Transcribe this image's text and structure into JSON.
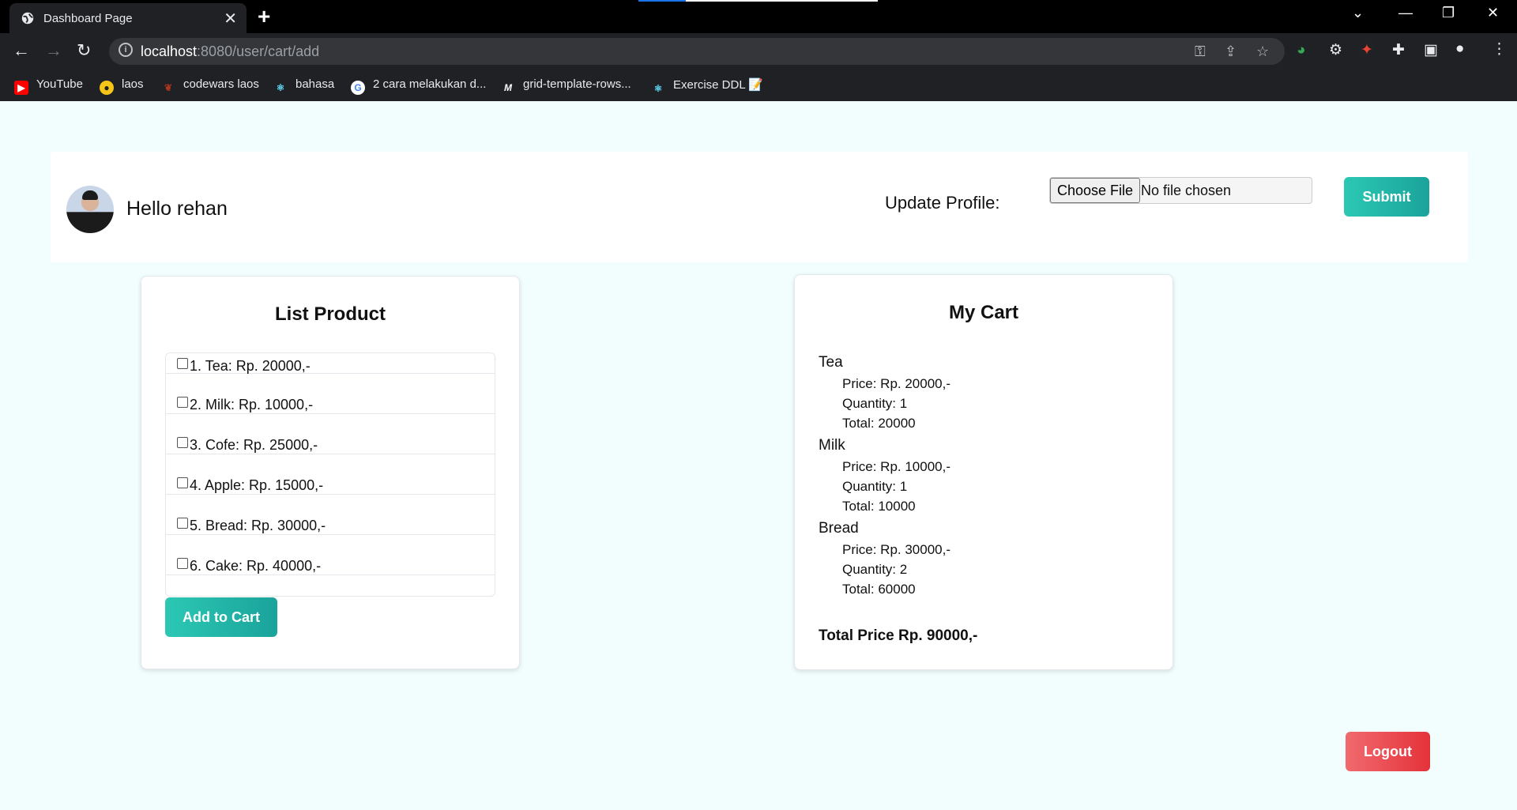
{
  "browser": {
    "tab_title": "Dashboard Page",
    "url_host": "localhost",
    "url_path": ":8080/user/cart/add",
    "bookmarks": [
      {
        "label": "YouTube",
        "icon": "youtube-icon",
        "color": "#ff0000"
      },
      {
        "label": "laos",
        "icon": "laos-icon",
        "color": "#f5c518"
      },
      {
        "label": "codewars laos",
        "icon": "codewars-icon",
        "color": "#b1361e"
      },
      {
        "label": "bahasa",
        "icon": "react-icon",
        "color": "#61dafb"
      },
      {
        "label": "2 cara melakukan d...",
        "icon": "google-icon",
        "color": "#4285f4"
      },
      {
        "label": "grid-template-rows...",
        "icon": "mdn-icon",
        "color": "#ffffff"
      },
      {
        "label": "Exercise DDL 📝",
        "icon": "react-icon",
        "color": "#61dafb"
      }
    ]
  },
  "header": {
    "greeting": "Hello rehan",
    "update_label": "Update Profile:",
    "choose_file": "Choose File",
    "no_file": "No file chosen",
    "submit_label": "Submit"
  },
  "products": {
    "title": "List Product",
    "items": [
      {
        "label": "1. Tea: Rp. 20000,-",
        "checked": false
      },
      {
        "label": "2. Milk: Rp. 10000,-",
        "checked": false
      },
      {
        "label": "3. Cofe: Rp. 25000,-",
        "checked": false
      },
      {
        "label": "4. Apple: Rp. 15000,-",
        "checked": false
      },
      {
        "label": "5. Bread: Rp. 30000,-",
        "checked": false
      },
      {
        "label": "6. Cake: Rp. 40000,-",
        "checked": false
      }
    ],
    "add_label": "Add to Cart"
  },
  "cart": {
    "title": "My Cart",
    "items": [
      {
        "name": "Tea",
        "price": "Price: Rp. 20000,-",
        "quantity": "Quantity: 1",
        "total": "Total: 20000"
      },
      {
        "name": "Milk",
        "price": "Price: Rp. 10000,-",
        "quantity": "Quantity: 1",
        "total": "Total: 10000"
      },
      {
        "name": "Bread",
        "price": "Price: Rp. 30000,-",
        "quantity": "Quantity: 2",
        "total": "Total: 60000"
      }
    ],
    "total_price": "Total Price Rp. 90000,-"
  },
  "logout_label": "Logout",
  "colors": {
    "page_bg": "#f2fefe",
    "teal_button": "#2cc8b4",
    "logout_button": "#e5323a"
  }
}
